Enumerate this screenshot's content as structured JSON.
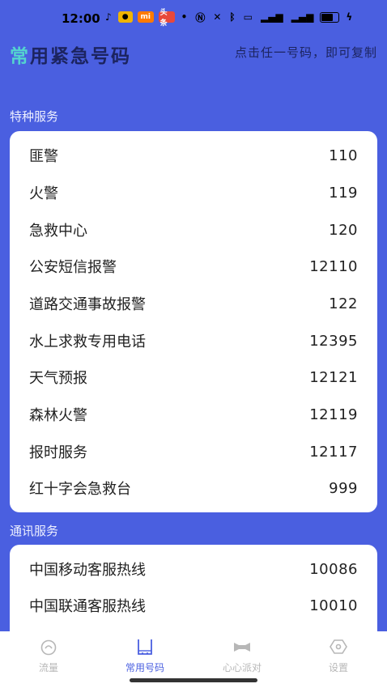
{
  "status_bar": {
    "time": "12:00",
    "icons": [
      "tiktok-icon",
      "app-icon-yellow",
      "mi-icon",
      "news-icon",
      "dot-icon",
      "nfc-icon",
      "mute-icon",
      "bluetooth-icon",
      "hd-icon",
      "signal-icon",
      "signal-icon",
      "battery-icon"
    ],
    "mi_label": "mi",
    "news_label": "头条"
  },
  "header": {
    "title_first": "常",
    "title_rest": "用紧急号码",
    "hint": "点击任一号码，即可复制"
  },
  "sections": [
    {
      "label": "特种服务",
      "items": [
        {
          "name": "匪警",
          "number": "110"
        },
        {
          "name": "火警",
          "number": "119"
        },
        {
          "name": "急救中心",
          "number": "120"
        },
        {
          "name": "公安短信报警",
          "number": "12110"
        },
        {
          "name": "道路交通事故报警",
          "number": "122"
        },
        {
          "name": "水上求救专用电话",
          "number": "12395"
        },
        {
          "name": "天气预报",
          "number": "12121"
        },
        {
          "name": "森林火警",
          "number": "12119"
        },
        {
          "name": "报时服务",
          "number": "12117"
        },
        {
          "name": "红十字会急救台",
          "number": "999"
        }
      ]
    },
    {
      "label": "通讯服务",
      "items": [
        {
          "name": "中国移动客服热线",
          "number": "10086"
        },
        {
          "name": "中国联通客服热线",
          "number": "10010"
        }
      ]
    }
  ],
  "tabs": [
    {
      "label": "流量",
      "icon": "traffic-icon",
      "active": false
    },
    {
      "label": "常用号码",
      "icon": "phone-book-icon",
      "active": true
    },
    {
      "label": "心心派对",
      "icon": "party-icon",
      "active": false
    },
    {
      "label": "设置",
      "icon": "settings-icon",
      "active": false
    }
  ],
  "colors": {
    "primary": "#4a5fe0",
    "title_dark": "#1c2460",
    "title_accent": "#54d4cf",
    "tab_inactive": "#b7b7b7"
  }
}
